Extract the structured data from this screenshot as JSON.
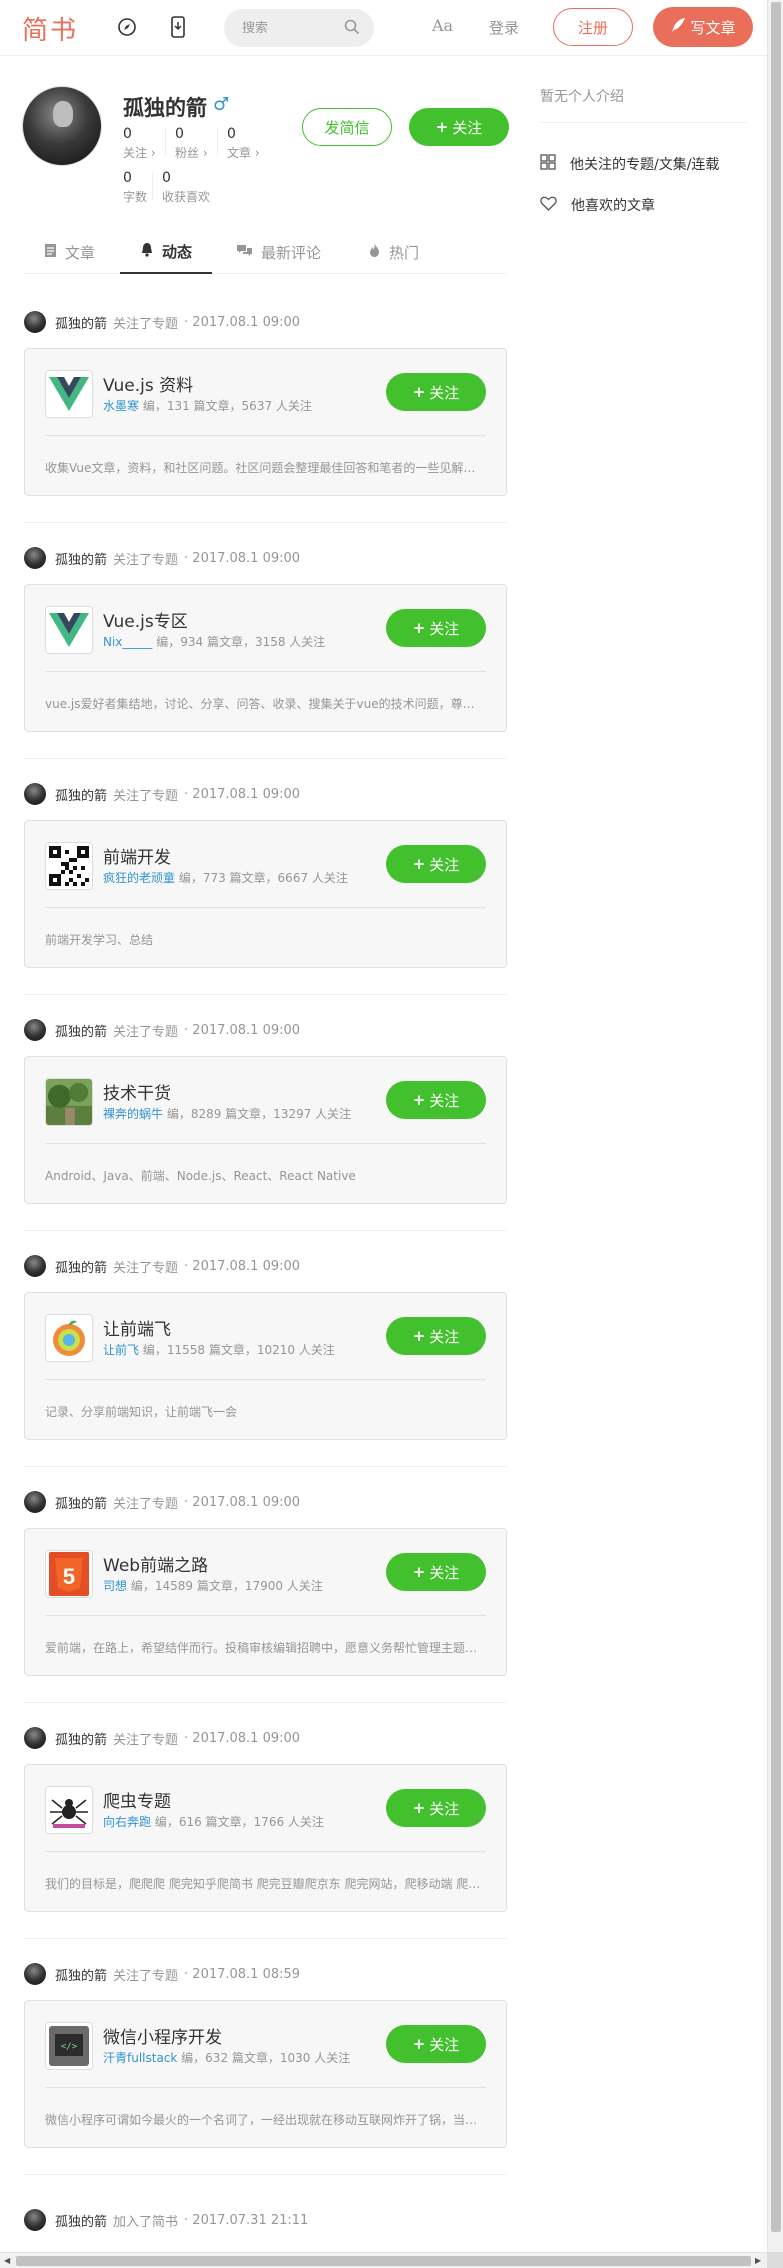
{
  "navbar": {
    "logo": "简书",
    "search_placeholder": "搜索",
    "aa_label": "Aa",
    "login": "登录",
    "signup": "注册",
    "write": "写文章"
  },
  "profile": {
    "name": "孤独的箭",
    "gender_symbol": "♂",
    "stats": [
      {
        "num": "0",
        "label": "关注 ›"
      },
      {
        "num": "0",
        "label": "粉丝 ›"
      },
      {
        "num": "0",
        "label": "文章 ›"
      },
      {
        "num": "0",
        "label": "字数"
      },
      {
        "num": "0",
        "label": "收获喜欢"
      }
    ],
    "message_button": "发简信",
    "follow_button": "关注",
    "follow_plus": "+"
  },
  "tabs": [
    {
      "label": "文章",
      "icon": "document-icon"
    },
    {
      "label": "动态",
      "icon": "bell-icon"
    },
    {
      "label": "最新评论",
      "icon": "comments-icon"
    },
    {
      "label": "热门",
      "icon": "fire-icon"
    }
  ],
  "feed": [
    {
      "author": "孤独的箭",
      "action": "关注了专题",
      "time": "· 2017.08.1 09:00",
      "title": "Vue.js 资料",
      "owner": "水墨寒",
      "info": " 编，131 篇文章，5637 人关注",
      "desc": "收集Vue文章，资料，和社区问题。社区问题会整理最佳回答和笔者的一些见解。社区问题会整理最佳回答",
      "thumb": "vue",
      "follow": "关注"
    },
    {
      "author": "孤独的箭",
      "action": "关注了专题",
      "time": "· 2017.08.1 09:00",
      "title": "Vue.js专区",
      "owner": "Nix_____",
      "info": " 编，934 篇文章，3158 人关注",
      "desc": "vue.js爱好者集结地，讨论、分享、问答、收录、搜集关于vue的技术问题，尊重原创",
      "thumb": "vue",
      "follow": "关注"
    },
    {
      "author": "孤独的箭",
      "action": "关注了专题",
      "time": "· 2017.08.1 09:00",
      "title": "前端开发",
      "owner": "疯狂的老顽童",
      "info": " 编，773 篇文章，6667 人关注",
      "desc": "前端开发学习、总结",
      "thumb": "qr",
      "follow": "关注"
    },
    {
      "author": "孤独的箭",
      "action": "关注了专题",
      "time": "· 2017.08.1 09:00",
      "title": "技术干货",
      "owner": "裸奔的蜗牛",
      "info": " 编，8289 篇文章，13297 人关注",
      "desc": "Android、Java、前端、Node.js、React、React Native",
      "thumb": "landscape",
      "follow": "关注"
    },
    {
      "author": "孤独的箭",
      "action": "关注了专题",
      "time": "· 2017.08.1 09:00",
      "title": "让前端飞",
      "owner": "让前飞",
      "info": " 编，11558 篇文章，10210 人关注",
      "desc": "记录、分享前端知识，让前端飞一会",
      "thumb": "apple",
      "follow": "关注"
    },
    {
      "author": "孤独的箭",
      "action": "关注了专题",
      "time": "· 2017.08.1 09:00",
      "title": "Web前端之路",
      "owner": "司想",
      "info": " 编，14589 篇文章，17900 人关注",
      "desc": "爱前端，在路上，希望结伴而行。投稿审核编辑招聘中，愿意义务帮忙管理主题的同学可以联系",
      "thumb": "html5",
      "follow": "关注"
    },
    {
      "author": "孤独的箭",
      "action": "关注了专题",
      "time": "· 2017.08.1 09:00",
      "title": "爬虫专题",
      "owner": "向右奔跑",
      "info": " 编，616 篇文章，1766 人关注",
      "desc": "我们的目标是，爬爬爬 爬完知乎爬简书 爬完豆瓣爬京东 爬完网站，爬移动端 爬爬爬",
      "thumb": "spider",
      "follow": "关注"
    },
    {
      "author": "孤独的箭",
      "action": "关注了专题",
      "time": "· 2017.08.1 08:59",
      "title": "微信小程序开发",
      "owner": "汗青fullstack",
      "info": " 编，632 篇文章，1030 人关注",
      "desc": "微信小程序可谓如今最火的一个名词了，一经出现就在移动互联网炸开了锅，当然也有很多开发者",
      "thumb": "code",
      "follow": "关注"
    }
  ],
  "final_event": {
    "author": "孤独的箭",
    "action": "加入了简书",
    "time": "· 2017.07.31 21:11"
  },
  "sidebar": {
    "intro": "暂无个人介绍",
    "links": [
      "他关注的专题/文集/连载",
      "他喜欢的文章"
    ]
  },
  "colors": {
    "brand": "#ea6f5a",
    "green": "#42c02e",
    "link": "#3194d0"
  }
}
